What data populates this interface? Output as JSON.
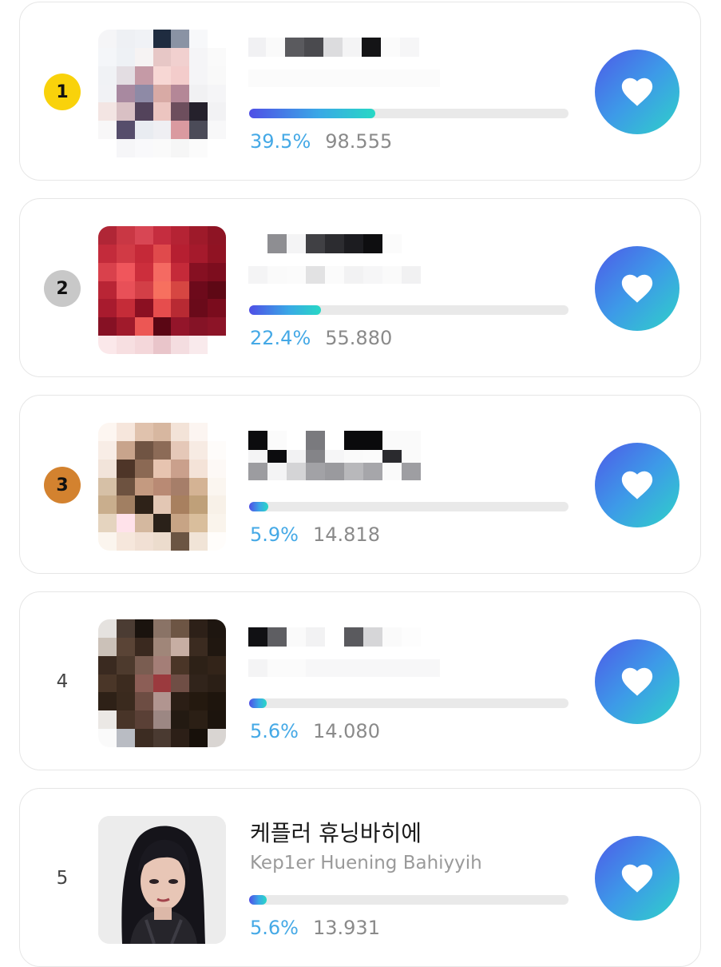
{
  "rankings": [
    {
      "rank": "1",
      "percent": "39.5%",
      "votes": "98.555",
      "percent_value": 39.5
    },
    {
      "rank": "2",
      "percent": "22.4%",
      "votes": "55.880",
      "percent_value": 22.4
    },
    {
      "rank": "3",
      "percent": "5.9%",
      "votes": "14.818",
      "percent_value": 5.9
    },
    {
      "rank": "4",
      "percent": "5.6%",
      "votes": "14.080",
      "percent_value": 5.6
    },
    {
      "rank": "5",
      "name": "케플러 휴닝바히에",
      "subname": "Kep1er Huening Bahiyyih",
      "percent": "5.6%",
      "votes": "13.931",
      "percent_value": 5.6
    }
  ],
  "colors": {
    "gold": "#f9d20b",
    "silver": "#c8c8c8",
    "bronze": "#d3822f",
    "percent_text": "#45a9e6",
    "bar_start": "#4f4fe6",
    "bar_end": "#27d8c5"
  },
  "icons": {
    "vote": "heart-icon"
  }
}
